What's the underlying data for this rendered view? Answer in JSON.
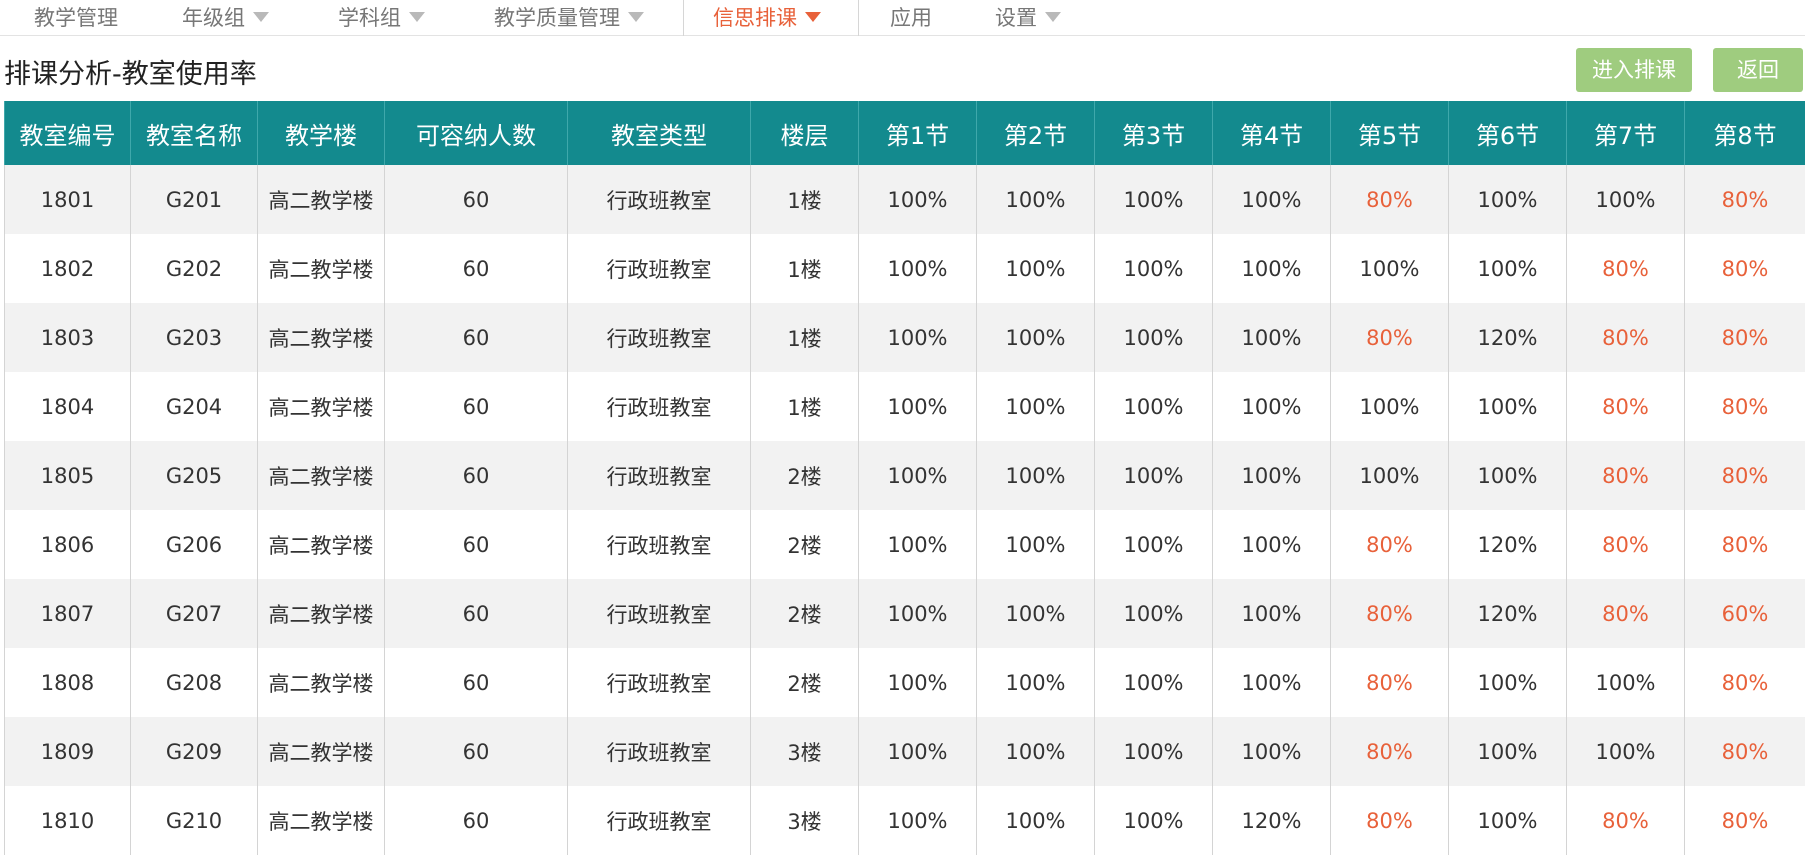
{
  "nav": {
    "items": [
      {
        "label": "教学管理",
        "dropdown": false,
        "active": false
      },
      {
        "label": "年级组",
        "dropdown": true,
        "active": false
      },
      {
        "label": "学科组",
        "dropdown": true,
        "active": false
      },
      {
        "label": "教学质量管理",
        "dropdown": true,
        "active": false
      },
      {
        "label": "信思排课",
        "dropdown": true,
        "active": true
      },
      {
        "label": "应用",
        "dropdown": false,
        "active": false
      },
      {
        "label": "设置",
        "dropdown": true,
        "active": false
      }
    ]
  },
  "page": {
    "title": "排课分析-教室使用率",
    "enter_button": "进入排课",
    "back_button": "返回"
  },
  "colors": {
    "header_bg": "#138a8e",
    "accent": "#e8613a",
    "button_bg": "#9fcc7f",
    "row_alt_bg": "#f2f2f2"
  },
  "table": {
    "columns": [
      "教室编号",
      "教室名称",
      "教学楼",
      "可容纳人数",
      "教室类型",
      "楼层",
      "第1节",
      "第2节",
      "第3节",
      "第4节",
      "第5节",
      "第6节",
      "第7节",
      "第8节"
    ],
    "rows": [
      [
        "1801",
        "G201",
        "高二教学楼",
        "60",
        "行政班教室",
        "1楼",
        "100%",
        "100%",
        "100%",
        "100%",
        "80%",
        "100%",
        "100%",
        "80%"
      ],
      [
        "1802",
        "G202",
        "高二教学楼",
        "60",
        "行政班教室",
        "1楼",
        "100%",
        "100%",
        "100%",
        "100%",
        "100%",
        "100%",
        "80%",
        "80%"
      ],
      [
        "1803",
        "G203",
        "高二教学楼",
        "60",
        "行政班教室",
        "1楼",
        "100%",
        "100%",
        "100%",
        "100%",
        "80%",
        "120%",
        "80%",
        "80%"
      ],
      [
        "1804",
        "G204",
        "高二教学楼",
        "60",
        "行政班教室",
        "1楼",
        "100%",
        "100%",
        "100%",
        "100%",
        "100%",
        "100%",
        "80%",
        "80%"
      ],
      [
        "1805",
        "G205",
        "高二教学楼",
        "60",
        "行政班教室",
        "2楼",
        "100%",
        "100%",
        "100%",
        "100%",
        "100%",
        "100%",
        "80%",
        "80%"
      ],
      [
        "1806",
        "G206",
        "高二教学楼",
        "60",
        "行政班教室",
        "2楼",
        "100%",
        "100%",
        "100%",
        "100%",
        "80%",
        "120%",
        "80%",
        "80%"
      ],
      [
        "1807",
        "G207",
        "高二教学楼",
        "60",
        "行政班教室",
        "2楼",
        "100%",
        "100%",
        "100%",
        "100%",
        "80%",
        "120%",
        "80%",
        "60%"
      ],
      [
        "1808",
        "G208",
        "高二教学楼",
        "60",
        "行政班教室",
        "2楼",
        "100%",
        "100%",
        "100%",
        "100%",
        "80%",
        "100%",
        "100%",
        "80%"
      ],
      [
        "1809",
        "G209",
        "高二教学楼",
        "60",
        "行政班教室",
        "3楼",
        "100%",
        "100%",
        "100%",
        "100%",
        "80%",
        "100%",
        "100%",
        "80%"
      ],
      [
        "1810",
        "G210",
        "高二教学楼",
        "60",
        "行政班教室",
        "3楼",
        "100%",
        "100%",
        "100%",
        "120%",
        "80%",
        "100%",
        "80%",
        "80%"
      ]
    ]
  }
}
